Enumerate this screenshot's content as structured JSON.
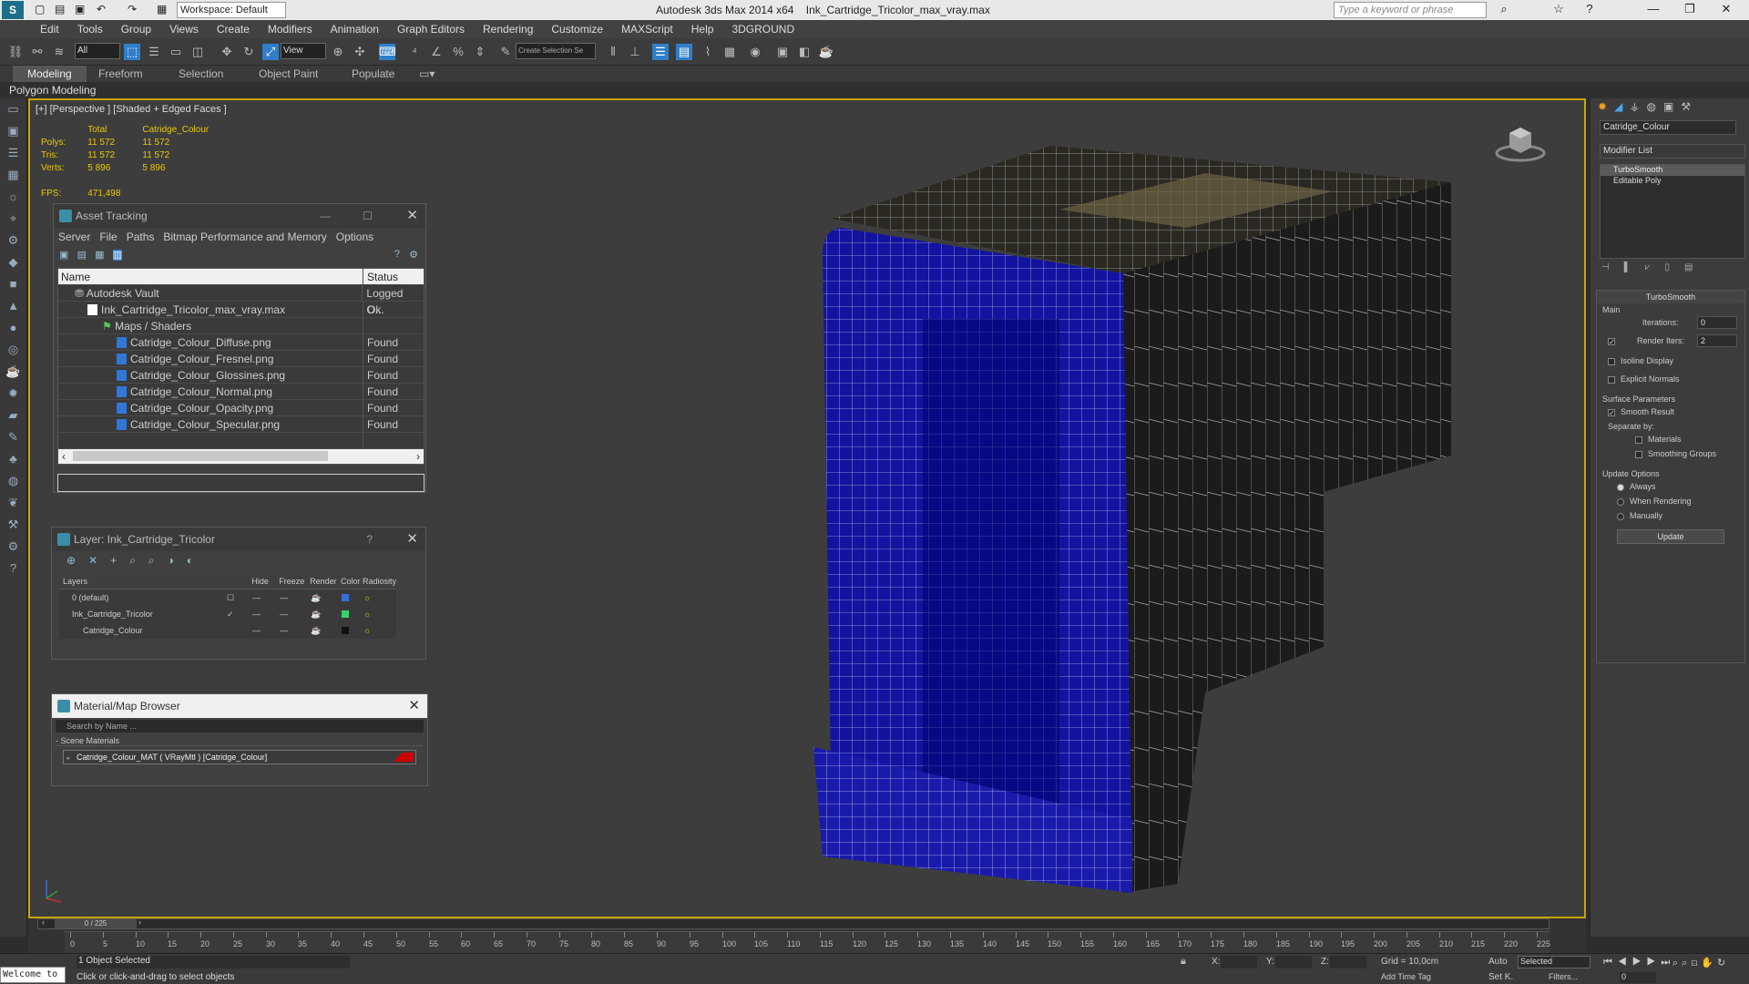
{
  "title": {
    "workspace": "Workspace: Default",
    "app": "Autodesk 3ds Max  2014 x64",
    "file": "Ink_Cartridge_Tricolor_max_vray.max",
    "search_placeholder": "Type a keyword or phrase"
  },
  "menu": [
    "Edit",
    "Tools",
    "Group",
    "Views",
    "Create",
    "Modifiers",
    "Animation",
    "Graph Editors",
    "Rendering",
    "Customize",
    "MAXScript",
    "Help",
    "3DGROUND"
  ],
  "toolbar": {
    "filter_select": "All",
    "view_select": "View",
    "selection_set": "Create Selection Se"
  },
  "ribbon": {
    "tabs": [
      "Modeling",
      "Freeform",
      "Selection",
      "Object Paint",
      "Populate"
    ],
    "sub": "Polygon Modeling"
  },
  "viewport": {
    "label": "[+] [Perspective ] [Shaded + Edged Faces ]",
    "stats": {
      "header": [
        "Total",
        "Catridge_Colour"
      ],
      "rows": [
        {
          "k": "Polys:",
          "a": "11 572",
          "b": "11 572"
        },
        {
          "k": "Tris:",
          "a": "11 572",
          "b": "11 572"
        },
        {
          "k": "Verts:",
          "a": "5 896",
          "b": "5 896"
        }
      ],
      "fps_label": "FPS:",
      "fps_value": "471,498"
    }
  },
  "asset_tracking": {
    "title": "Asset Tracking",
    "menu": [
      "Server",
      "File",
      "Paths",
      "Bitmap Performance and Memory",
      "Options"
    ],
    "columns": [
      "Name",
      "Status"
    ],
    "rows": [
      {
        "name": "Autodesk Vault",
        "status": "Logged O..."
      },
      {
        "name": "Ink_Cartridge_Tricolor_max_vray.max",
        "status": "Ok"
      },
      {
        "name": "Maps / Shaders",
        "status": ""
      },
      {
        "name": "Catridge_Colour_Diffuse.png",
        "status": "Found"
      },
      {
        "name": "Catridge_Colour_Fresnel.png",
        "status": "Found"
      },
      {
        "name": "Catridge_Colour_Glossines.png",
        "status": "Found"
      },
      {
        "name": "Catridge_Colour_Normal.png",
        "status": "Found"
      },
      {
        "name": "Catridge_Colour_Opacity.png",
        "status": "Found"
      },
      {
        "name": "Catridge_Colour_Specular.png",
        "status": "Found"
      }
    ]
  },
  "layer": {
    "title": "Layer: Ink_Cartridge_Tricolor",
    "help": "?",
    "columns": [
      "Layers",
      "Hide",
      "Freeze",
      "Render",
      "Color",
      "Radiosity"
    ],
    "rows": [
      {
        "name": "0 (default)",
        "color": "#3a6fd8"
      },
      {
        "name": "Ink_Cartridge_Tricolor",
        "color": "#3ad070"
      },
      {
        "name": "Catridge_Colour",
        "color": "#111111"
      }
    ]
  },
  "material_browser": {
    "title": "Material/Map Browser",
    "search_placeholder": "Search by Name ...",
    "section": "- Scene Materials",
    "item": "Catridge_Colour_MAT ( VRayMtl ) [Catridge_Colour]"
  },
  "command_panel": {
    "object_name": "Catridge_Colour",
    "modifier_list": "Modifier List",
    "stack": [
      "TurboSmooth",
      "Editable Poly"
    ],
    "rollout": "TurboSmooth",
    "main": "Main",
    "iterations_label": "Iterations:",
    "iterations": "0",
    "render_iters_label": "Render Iters:",
    "render_iters": "2",
    "isoline": "Isoline Display",
    "explicit": "Explicit Normals",
    "surface": "Surface Parameters",
    "smooth_result": "Smooth Result",
    "separate_by": "Separate by:",
    "materials": "Materials",
    "smoothing_groups": "Smoothing Groups",
    "update_options": "Update Options",
    "always": "Always",
    "when_rendering": "When Rendering",
    "manually": "Manually",
    "update_btn": "Update"
  },
  "timeline": {
    "frame": "0 / 225",
    "ticks": [
      "0",
      "5",
      "10",
      "15",
      "20",
      "25",
      "30",
      "35",
      "40",
      "45",
      "50",
      "55",
      "60",
      "65",
      "70",
      "75",
      "80",
      "85",
      "90",
      "95",
      "100",
      "105",
      "110",
      "115",
      "120",
      "125",
      "130",
      "135",
      "140",
      "145",
      "150",
      "155",
      "160",
      "165",
      "170",
      "175",
      "180",
      "185",
      "190",
      "195",
      "200",
      "205",
      "210",
      "215",
      "220",
      "225"
    ]
  },
  "status": {
    "listener": "Welcome to",
    "selected": "1 Object Selected",
    "hint": "Click or click-and-drag to select objects",
    "x": "X:",
    "y": "Y:",
    "z": "Z:",
    "grid": "Grid = 10,0cm",
    "add_time_tag": "Add Time Tag",
    "auto": "Auto",
    "set_key": "Set K.",
    "selected_dd": "Selected",
    "filters": "Filters...",
    "frame_num": "0"
  }
}
